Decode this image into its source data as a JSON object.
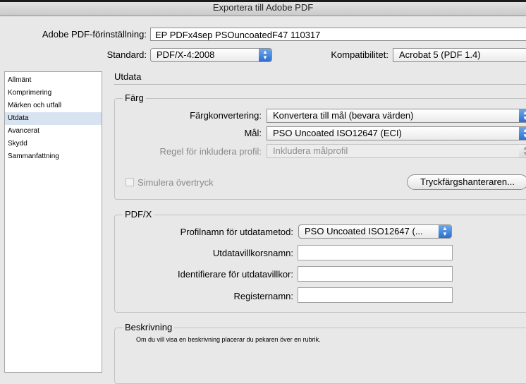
{
  "window": {
    "title": "Exportera till Adobe PDF"
  },
  "header": {
    "preset_label": "Adobe PDF-förinställning:",
    "preset_value": "EP PDFx4sep PSOuncoatedF47 110317",
    "standard_label": "Standard:",
    "standard_value": "PDF/X-4:2008",
    "compat_label": "Kompatibilitet:",
    "compat_value": "Acrobat 5 (PDF 1.4)"
  },
  "sidebar": {
    "items": [
      {
        "label": "Allmänt"
      },
      {
        "label": "Komprimering"
      },
      {
        "label": "Märken och utfall"
      },
      {
        "label": "Utdata"
      },
      {
        "label": "Avancerat"
      },
      {
        "label": "Skydd"
      },
      {
        "label": "Sammanfattning"
      }
    ],
    "selected": "Utdata"
  },
  "main": {
    "section_title": "Utdata",
    "color_group": {
      "title": "Färg",
      "conversion_label": "Färgkonvertering:",
      "conversion_value": "Konvertera till mål (bevara värden)",
      "destination_label": "Mål:",
      "destination_value": "PSO Uncoated ISO12647 (ECI)",
      "profile_rule_label": "Regel för inkludera profil:",
      "profile_rule_value": "Inkludera målprofil",
      "simulate_label": "Simulera övertryck",
      "ink_manager_label": "Tryckfärgshanteraren..."
    },
    "pdfx_group": {
      "title": "PDF/X",
      "output_profile_label": "Profilnamn för utdatametod:",
      "output_profile_value": "PSO Uncoated ISO12647 (...",
      "condition_name_label": "Utdatavillkorsnamn:",
      "condition_name_value": "",
      "condition_id_label": "Identifierare för utdatavillkor:",
      "condition_id_value": "",
      "registry_label": "Registernamn:",
      "registry_value": ""
    },
    "description_group": {
      "title": "Beskrivning",
      "text": "Om du vill visa en beskrivning placerar du pekaren över en rubrik."
    }
  }
}
